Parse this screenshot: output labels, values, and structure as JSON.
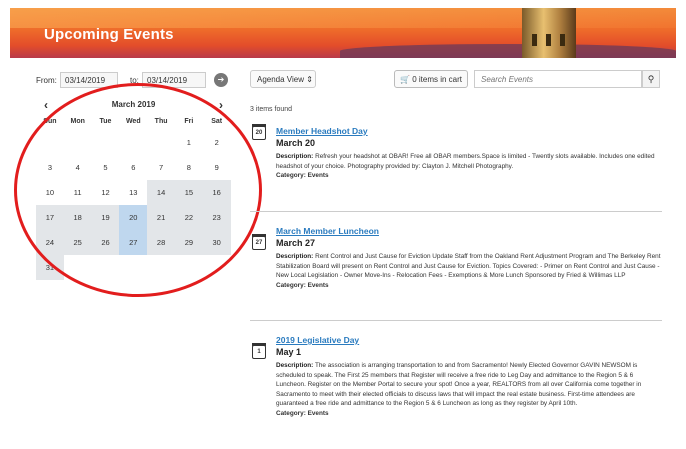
{
  "header": {
    "title": "Upcoming Events"
  },
  "filters": {
    "from_label": "From:",
    "from_value": "03/14/2019",
    "to_label": "to:",
    "to_value": "03/14/2019",
    "go_icon": "arrow-right-icon"
  },
  "calendar": {
    "month": "March 2019",
    "prev": "‹",
    "next": "›",
    "weekdays": [
      "Sun",
      "Mon",
      "Tue",
      "Wed",
      "Thu",
      "Fri",
      "Sat"
    ],
    "weeks": [
      [
        "",
        "",
        "",
        "",
        "",
        "1",
        "2"
      ],
      [
        "3",
        "4",
        "5",
        "6",
        "7",
        "8",
        "9"
      ],
      [
        "10",
        "11",
        "12",
        "13",
        "14",
        "15",
        "16"
      ],
      [
        "17",
        "18",
        "19",
        "20",
        "21",
        "22",
        "23"
      ],
      [
        "24",
        "25",
        "26",
        "27",
        "28",
        "29",
        "30"
      ],
      [
        "31",
        "",
        "",
        "",
        "",
        "",
        ""
      ]
    ],
    "highlighted_days": [
      "20",
      "27"
    ],
    "annotation_color": "#e21d1d"
  },
  "toolbar": {
    "view_select": "Agenda View ⇕",
    "cart_label": "0 items in cart",
    "search_placeholder": "Search Events",
    "search_icon": "search-icon"
  },
  "results": {
    "count_text": "3 items found"
  },
  "events": [
    {
      "title": "Member Headshot Day",
      "date": "March 20",
      "icon_day": "20",
      "desc_label": "Description:",
      "desc": "Refresh your headshot at OBAR! Free all OBAR members.Space is limited - Twently slots available. Includes one edited headshot of your choice. Photography provided by: Clayton J. Mitchell Photography.",
      "category": "Category: Events"
    },
    {
      "title": "March Member Luncheon",
      "date": "March 27",
      "icon_day": "27",
      "desc_label": "Description:",
      "desc": "Rent Control and Just Cause for Eviction Update Staff from the Oakland Rent Adjustment Program and The Berkeley Rent Stabilization Board will present on Rent Control and Just Cause for Eviction. Topics Covered: - Primer on Rent Control and Just Cause - New Local Legislation - Owner Move-Ins - Relocation Fees - Exemptions & More Lunch Sponsored by Fried & Willimas LLP",
      "category": "Category: Events"
    },
    {
      "title": "2019 Legislative Day",
      "date": "May 1",
      "icon_day": "1",
      "desc_label": "Description:",
      "desc": "The association is arranging transportation to and from Sacramento! Newly Elected Governor GAVIN NEWSOM is scheduled to speak. The First 25 members that Register will receive a free ride to Leg Day and admittance to the Region 5 & 6 Luncheon. Register on the Member Portal to secure your spot! Once a year, REALTORS from all over California come together in Sacramento to meet with their elected officials to discuss laws that will impact the real estate business. First-time attendees are guaranteed a free ride and admittance to the Region 5 & 6 Luncheon as long as they register by April 10th.",
      "category": "Category: Events"
    }
  ]
}
